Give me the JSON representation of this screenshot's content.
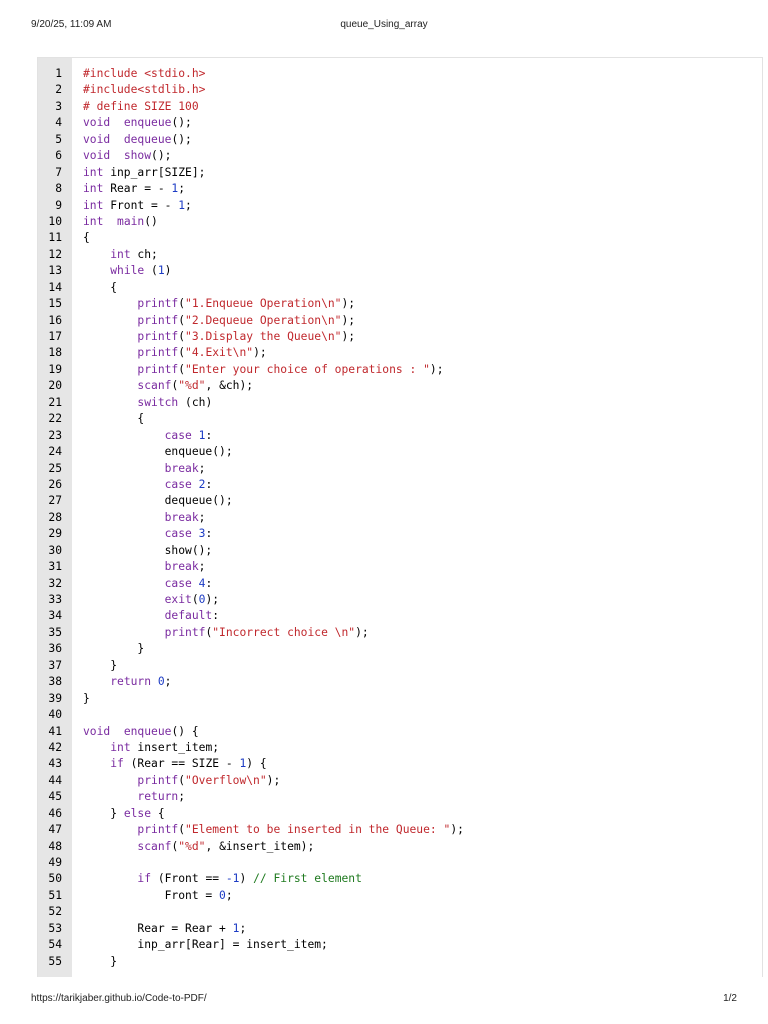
{
  "header": {
    "datetime": "9/20/25, 11:09 AM",
    "title": "queue_Using_array"
  },
  "footer": {
    "url": "https://tarikjaber.github.io/Code-to-PDF/",
    "page": "1/2"
  },
  "colors": {
    "keyword": "#7a2ba0",
    "string": "#c0282d",
    "number": "#1c3bc4",
    "comment": "#1f7a1f",
    "gutter": "#e6e6e6"
  },
  "code_lines": [
    [
      [
        "pp",
        "#include <stdio.h>"
      ]
    ],
    [
      [
        "pp",
        "#include<stdlib.h>"
      ]
    ],
    [
      [
        "pp",
        "# define SIZE 100"
      ]
    ],
    [
      [
        "tp",
        "void"
      ],
      [
        "",
        "  "
      ],
      [
        "fn",
        "enqueue"
      ],
      [
        "",
        "();"
      ]
    ],
    [
      [
        "tp",
        "void"
      ],
      [
        "",
        "  "
      ],
      [
        "fn",
        "dequeue"
      ],
      [
        "",
        "();"
      ]
    ],
    [
      [
        "tp",
        "void"
      ],
      [
        "",
        "  "
      ],
      [
        "fn",
        "show"
      ],
      [
        "",
        "();"
      ]
    ],
    [
      [
        "tp",
        "int"
      ],
      [
        "",
        " inp_arr[SIZE];"
      ]
    ],
    [
      [
        "tp",
        "int"
      ],
      [
        "",
        " Rear = - "
      ],
      [
        "num",
        "1"
      ],
      [
        "",
        ";"
      ]
    ],
    [
      [
        "tp",
        "int"
      ],
      [
        "",
        " Front = - "
      ],
      [
        "num",
        "1"
      ],
      [
        "",
        ";"
      ]
    ],
    [
      [
        "tp",
        "int"
      ],
      [
        "",
        "  "
      ],
      [
        "fn",
        "main"
      ],
      [
        "",
        "()"
      ]
    ],
    [
      [
        "",
        "{"
      ]
    ],
    [
      [
        "",
        "    "
      ],
      [
        "tp",
        "int"
      ],
      [
        "",
        " ch;"
      ]
    ],
    [
      [
        "",
        "    "
      ],
      [
        "kw",
        "while"
      ],
      [
        "",
        " ("
      ],
      [
        "num",
        "1"
      ],
      [
        "",
        ")"
      ]
    ],
    [
      [
        "",
        "    {"
      ]
    ],
    [
      [
        "",
        "        "
      ],
      [
        "fn",
        "printf"
      ],
      [
        "",
        "("
      ],
      [
        "str",
        "\"1.Enqueue Operation\\n\""
      ],
      [
        "",
        ");"
      ]
    ],
    [
      [
        "",
        "        "
      ],
      [
        "fn",
        "printf"
      ],
      [
        "",
        "("
      ],
      [
        "str",
        "\"2.Dequeue Operation\\n\""
      ],
      [
        "",
        ");"
      ]
    ],
    [
      [
        "",
        "        "
      ],
      [
        "fn",
        "printf"
      ],
      [
        "",
        "("
      ],
      [
        "str",
        "\"3.Display the Queue\\n\""
      ],
      [
        "",
        ");"
      ]
    ],
    [
      [
        "",
        "        "
      ],
      [
        "fn",
        "printf"
      ],
      [
        "",
        "("
      ],
      [
        "str",
        "\"4.Exit\\n\""
      ],
      [
        "",
        ");"
      ]
    ],
    [
      [
        "",
        "        "
      ],
      [
        "fn",
        "printf"
      ],
      [
        "",
        "("
      ],
      [
        "str",
        "\"Enter your choice of operations : \""
      ],
      [
        "",
        ");"
      ]
    ],
    [
      [
        "",
        "        "
      ],
      [
        "fn",
        "scanf"
      ],
      [
        "",
        "("
      ],
      [
        "str",
        "\"%d\""
      ],
      [
        "",
        ", &ch);"
      ]
    ],
    [
      [
        "",
        "        "
      ],
      [
        "kw",
        "switch"
      ],
      [
        "",
        " (ch)"
      ]
    ],
    [
      [
        "",
        "        {"
      ]
    ],
    [
      [
        "",
        "            "
      ],
      [
        "kw",
        "case"
      ],
      [
        "",
        " "
      ],
      [
        "num",
        "1"
      ],
      [
        "",
        ":"
      ]
    ],
    [
      [
        "",
        "            enqueue();"
      ]
    ],
    [
      [
        "",
        "            "
      ],
      [
        "kw",
        "break"
      ],
      [
        "",
        ";"
      ]
    ],
    [
      [
        "",
        "            "
      ],
      [
        "kw",
        "case"
      ],
      [
        "",
        " "
      ],
      [
        "num",
        "2"
      ],
      [
        "",
        ":"
      ]
    ],
    [
      [
        "",
        "            dequeue();"
      ]
    ],
    [
      [
        "",
        "            "
      ],
      [
        "kw",
        "break"
      ],
      [
        "",
        ";"
      ]
    ],
    [
      [
        "",
        "            "
      ],
      [
        "kw",
        "case"
      ],
      [
        "",
        " "
      ],
      [
        "num",
        "3"
      ],
      [
        "",
        ":"
      ]
    ],
    [
      [
        "",
        "            show();"
      ]
    ],
    [
      [
        "",
        "            "
      ],
      [
        "kw",
        "break"
      ],
      [
        "",
        ";"
      ]
    ],
    [
      [
        "",
        "            "
      ],
      [
        "kw",
        "case"
      ],
      [
        "",
        " "
      ],
      [
        "num",
        "4"
      ],
      [
        "",
        ":"
      ]
    ],
    [
      [
        "",
        "            "
      ],
      [
        "fn",
        "exit"
      ],
      [
        "",
        "("
      ],
      [
        "num",
        "0"
      ],
      [
        "",
        ");"
      ]
    ],
    [
      [
        "",
        "            "
      ],
      [
        "kw",
        "default"
      ],
      [
        "",
        ":"
      ]
    ],
    [
      [
        "",
        "            "
      ],
      [
        "fn",
        "printf"
      ],
      [
        "",
        "("
      ],
      [
        "str",
        "\"Incorrect choice \\n\""
      ],
      [
        "",
        ");"
      ]
    ],
    [
      [
        "",
        "        }"
      ]
    ],
    [
      [
        "",
        "    }"
      ]
    ],
    [
      [
        "",
        "    "
      ],
      [
        "kw",
        "return"
      ],
      [
        "",
        " "
      ],
      [
        "num",
        "0"
      ],
      [
        "",
        ";"
      ]
    ],
    [
      [
        "",
        "}"
      ]
    ],
    [
      [
        "",
        ""
      ]
    ],
    [
      [
        "tp",
        "void"
      ],
      [
        "",
        "  "
      ],
      [
        "fn",
        "enqueue"
      ],
      [
        "",
        "() {"
      ]
    ],
    [
      [
        "",
        "    "
      ],
      [
        "tp",
        "int"
      ],
      [
        "",
        " insert_item;"
      ]
    ],
    [
      [
        "",
        "    "
      ],
      [
        "kw",
        "if"
      ],
      [
        "",
        " (Rear == SIZE - "
      ],
      [
        "num",
        "1"
      ],
      [
        "",
        ") {"
      ]
    ],
    [
      [
        "",
        "        "
      ],
      [
        "fn",
        "printf"
      ],
      [
        "",
        "("
      ],
      [
        "str",
        "\"Overflow\\n\""
      ],
      [
        "",
        ");"
      ]
    ],
    [
      [
        "",
        "        "
      ],
      [
        "kw",
        "return"
      ],
      [
        "",
        ";"
      ]
    ],
    [
      [
        "",
        "    } "
      ],
      [
        "kw",
        "else"
      ],
      [
        "",
        " {"
      ]
    ],
    [
      [
        "",
        "        "
      ],
      [
        "fn",
        "printf"
      ],
      [
        "",
        "("
      ],
      [
        "str",
        "\"Element to be inserted in the Queue: \""
      ],
      [
        "",
        ");"
      ]
    ],
    [
      [
        "",
        "        "
      ],
      [
        "fn",
        "scanf"
      ],
      [
        "",
        "("
      ],
      [
        "str",
        "\"%d\""
      ],
      [
        "",
        ", &insert_item);"
      ]
    ],
    [
      [
        "",
        ""
      ]
    ],
    [
      [
        "",
        "        "
      ],
      [
        "kw",
        "if"
      ],
      [
        "",
        " (Front == "
      ],
      [
        "num",
        "-1"
      ],
      [
        "",
        ") "
      ],
      [
        "cm",
        "// First element"
      ]
    ],
    [
      [
        "",
        "            Front = "
      ],
      [
        "num",
        "0"
      ],
      [
        "",
        ";"
      ]
    ],
    [
      [
        "",
        ""
      ]
    ],
    [
      [
        "",
        "        Rear = Rear + "
      ],
      [
        "num",
        "1"
      ],
      [
        "",
        ";"
      ]
    ],
    [
      [
        "",
        "        inp_arr[Rear] = insert_item;"
      ]
    ],
    [
      [
        "",
        "    }"
      ]
    ]
  ]
}
